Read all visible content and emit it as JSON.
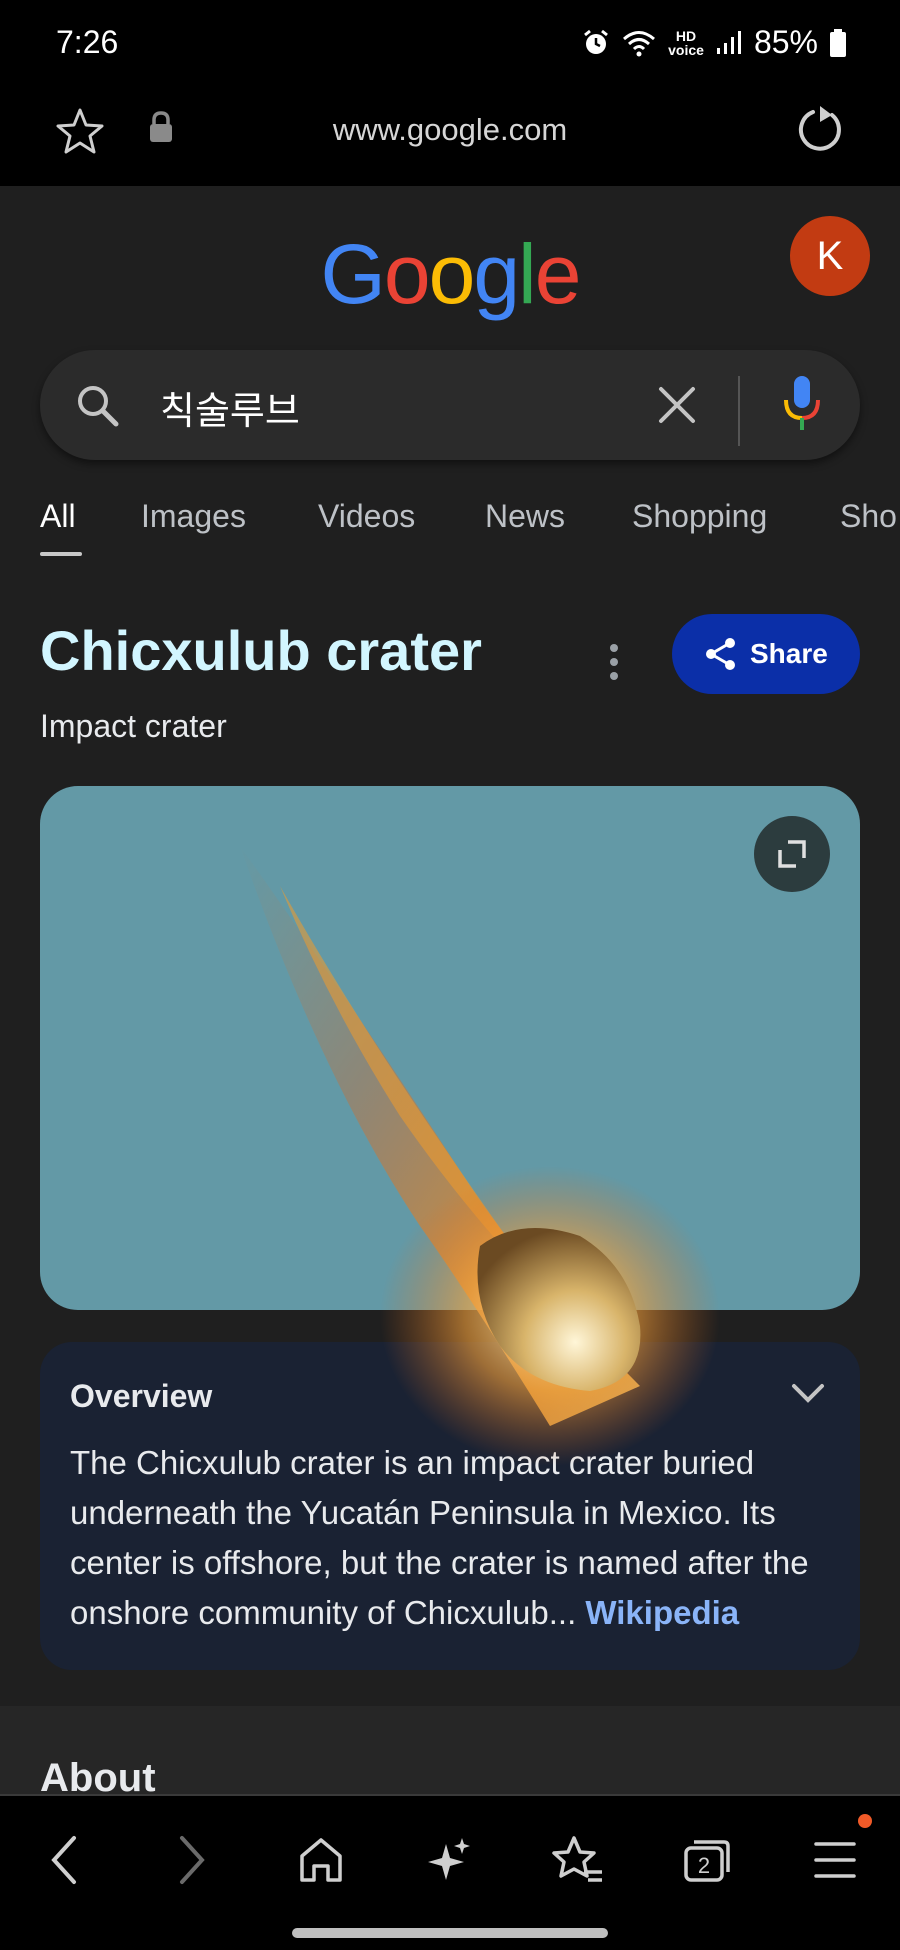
{
  "status_bar": {
    "time": "7:26",
    "battery": "85%"
  },
  "browser": {
    "url": "www.google.com"
  },
  "account": {
    "initial": "K",
    "avatar_color": "#c23b12"
  },
  "google_logo": {
    "letters": [
      {
        "char": "G",
        "color": "#4285f4"
      },
      {
        "char": "o",
        "color": "#ea4335"
      },
      {
        "char": "o",
        "color": "#fbbc05"
      },
      {
        "char": "g",
        "color": "#4285f4"
      },
      {
        "char": "l",
        "color": "#34a853"
      },
      {
        "char": "e",
        "color": "#ea4335"
      }
    ]
  },
  "search": {
    "query": "칙술루브"
  },
  "tabs": [
    {
      "label": "All",
      "active": true
    },
    {
      "label": "Images"
    },
    {
      "label": "Videos"
    },
    {
      "label": "News"
    },
    {
      "label": "Shopping"
    },
    {
      "label": "Sho"
    }
  ],
  "knowledge_panel": {
    "title": "Chicxulub crater",
    "subtitle": "Impact crater",
    "share_label": "Share",
    "overview": {
      "heading": "Overview",
      "text": "The Chicxulub crater is an impact crater buried underneath the Yucatán Peninsula in Mexico. Its center is offshore, but the crater is named after the onshore community of Chicxulub...",
      "source_link": "Wikipedia"
    },
    "next_section_peek": "About"
  },
  "colors": {
    "title_color": "#d2f6ff",
    "share_bg": "#0b2fa8",
    "hero_bg": "#6399a6",
    "link_color": "#8ab4f8"
  }
}
